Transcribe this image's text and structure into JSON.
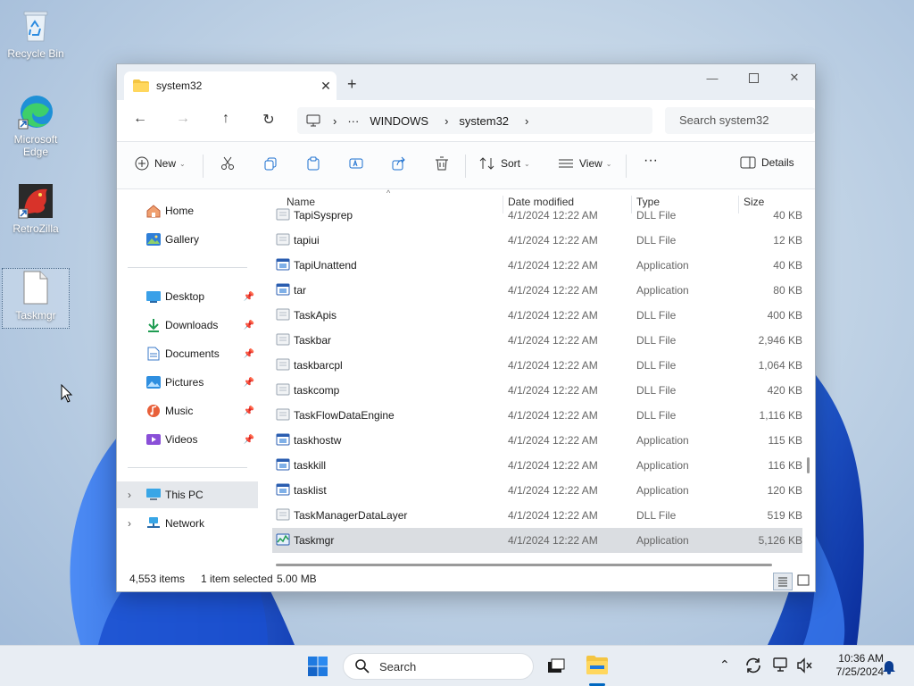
{
  "desktop": {
    "icons": [
      {
        "label": "Recycle Bin"
      },
      {
        "label": "Microsoft Edge"
      },
      {
        "label": "RetroZilla"
      },
      {
        "label": "Taskmgr"
      }
    ]
  },
  "window": {
    "tab_title": "system32",
    "breadcrumbs": [
      "WINDOWS",
      "system32"
    ],
    "search_placeholder": "Search system32",
    "commands": {
      "new": "New",
      "sort": "Sort",
      "view": "View",
      "details": "Details"
    },
    "nav": {
      "home": "Home",
      "gallery": "Gallery",
      "desktop": "Desktop",
      "downloads": "Downloads",
      "documents": "Documents",
      "pictures": "Pictures",
      "music": "Music",
      "videos": "Videos",
      "this_pc": "This PC",
      "network": "Network"
    },
    "columns": {
      "name": "Name",
      "date": "Date modified",
      "type": "Type",
      "size": "Size"
    },
    "files": [
      {
        "name": "TapiSysprep",
        "date": "4/1/2024 12:22 AM",
        "type": "DLL File",
        "size": "40 KB",
        "kind": "dll"
      },
      {
        "name": "tapiui",
        "date": "4/1/2024 12:22 AM",
        "type": "DLL File",
        "size": "12 KB",
        "kind": "dll"
      },
      {
        "name": "TapiUnattend",
        "date": "4/1/2024 12:22 AM",
        "type": "Application",
        "size": "40 KB",
        "kind": "app"
      },
      {
        "name": "tar",
        "date": "4/1/2024 12:22 AM",
        "type": "Application",
        "size": "80 KB",
        "kind": "app"
      },
      {
        "name": "TaskApis",
        "date": "4/1/2024 12:22 AM",
        "type": "DLL File",
        "size": "400 KB",
        "kind": "dll"
      },
      {
        "name": "Taskbar",
        "date": "4/1/2024 12:22 AM",
        "type": "DLL File",
        "size": "2,946 KB",
        "kind": "dll"
      },
      {
        "name": "taskbarcpl",
        "date": "4/1/2024 12:22 AM",
        "type": "DLL File",
        "size": "1,064 KB",
        "kind": "dll"
      },
      {
        "name": "taskcomp",
        "date": "4/1/2024 12:22 AM",
        "type": "DLL File",
        "size": "420 KB",
        "kind": "dll"
      },
      {
        "name": "TaskFlowDataEngine",
        "date": "4/1/2024 12:22 AM",
        "type": "DLL File",
        "size": "1,116 KB",
        "kind": "dll"
      },
      {
        "name": "taskhostw",
        "date": "4/1/2024 12:22 AM",
        "type": "Application",
        "size": "115 KB",
        "kind": "app"
      },
      {
        "name": "taskkill",
        "date": "4/1/2024 12:22 AM",
        "type": "Application",
        "size": "116 KB",
        "kind": "app"
      },
      {
        "name": "tasklist",
        "date": "4/1/2024 12:22 AM",
        "type": "Application",
        "size": "120 KB",
        "kind": "app"
      },
      {
        "name": "TaskManagerDataLayer",
        "date": "4/1/2024 12:22 AM",
        "type": "DLL File",
        "size": "519 KB",
        "kind": "dll"
      },
      {
        "name": "Taskmgr",
        "date": "4/1/2024 12:22 AM",
        "type": "Application",
        "size": "5,126 KB",
        "kind": "taskmgr",
        "selected": true
      }
    ],
    "status": {
      "items": "4,553 items",
      "selected": "1 item selected",
      "size": "5.00 MB"
    }
  },
  "taskbar": {
    "search": "Search",
    "time": "10:36 AM",
    "date": "7/25/2024"
  },
  "colors": {
    "accent": "#0067c0",
    "selection": "#dadde1",
    "folder": "#f4c542"
  }
}
